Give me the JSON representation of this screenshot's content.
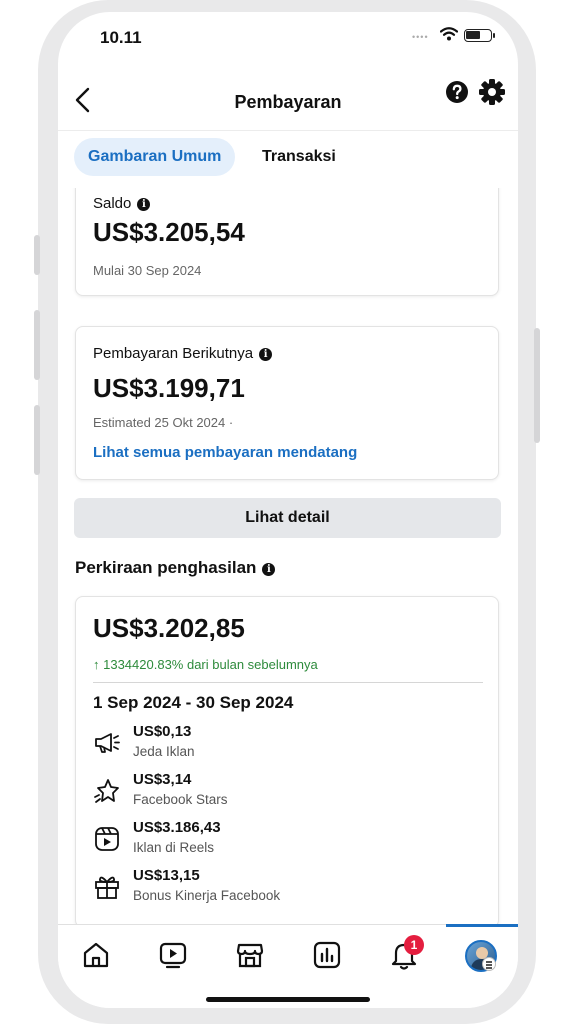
{
  "status_bar": {
    "time": "10.11"
  },
  "header": {
    "title": "Pembayaran"
  },
  "tabs": [
    {
      "label": "Gambaran Umum",
      "active": true
    },
    {
      "label": "Transaksi",
      "active": false
    }
  ],
  "balance": {
    "label": "Saldo",
    "amount": "US$3.205,54",
    "since": "Mulai 30 Sep 2024"
  },
  "next_payment": {
    "label": "Pembayaran Berikutnya",
    "amount": "US$3.199,71",
    "estimated": "Estimated 25 Okt 2024 ·",
    "link": "Lihat semua pembayaran mendatang"
  },
  "detail_button": "Lihat detail",
  "estimated_earnings": {
    "title": "Perkiraan penghasilan",
    "amount": "US$3.202,85",
    "growth": "↑ 1334420.83% dari bulan sebelumnya",
    "period": "1 Sep 2024 - 30 Sep 2024",
    "items": [
      {
        "amount": "US$0,13",
        "source": "Jeda Iklan",
        "icon": "megaphone-icon"
      },
      {
        "amount": "US$3,14",
        "source": "Facebook Stars",
        "icon": "star-icon"
      },
      {
        "amount": "US$3.186,43",
        "source": "Iklan di Reels",
        "icon": "reels-icon"
      },
      {
        "amount": "US$13,15",
        "source": "Bonus Kinerja Facebook",
        "icon": "gift-icon"
      }
    ]
  },
  "bottom_nav": {
    "items": [
      "home-icon",
      "video-icon",
      "marketplace-icon",
      "dashboard-icon",
      "bell-icon",
      "profile-avatar"
    ],
    "notification_count": "1",
    "active": "profile-avatar"
  },
  "colors": {
    "accent": "#1b6fc2",
    "positive": "#2e8b3c",
    "badge": "#e41e3f"
  }
}
